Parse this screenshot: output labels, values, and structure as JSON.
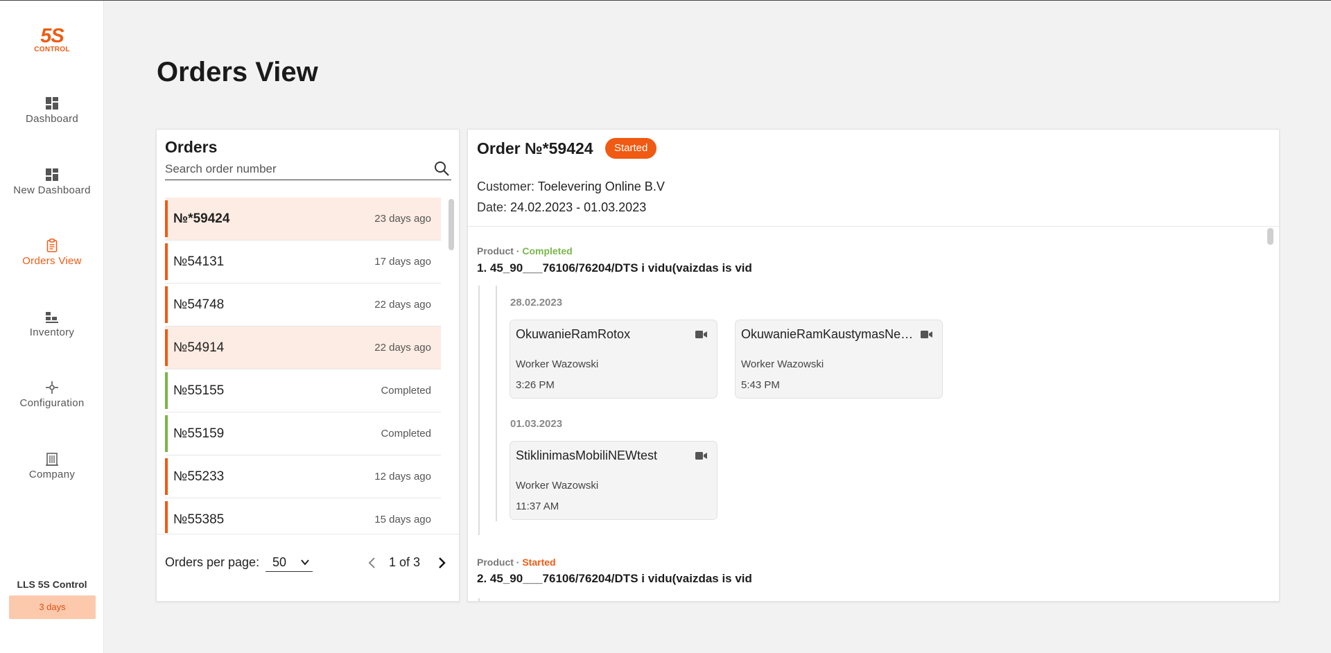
{
  "sidebar": {
    "logo": {
      "big": "5S",
      "small": "CONTROL"
    },
    "items": [
      {
        "label": "Dashboard",
        "icon": "dashboard-icon",
        "active": false
      },
      {
        "label": "New Dashboard",
        "icon": "dashboard-icon",
        "active": false
      },
      {
        "label": "Orders View",
        "icon": "clipboard-icon",
        "active": true
      },
      {
        "label": "Inventory",
        "icon": "inventory-icon",
        "active": false
      },
      {
        "label": "Configuration",
        "icon": "configuration-icon",
        "active": false
      },
      {
        "label": "Company",
        "icon": "building-icon",
        "active": false
      }
    ],
    "brand_name": "LLS 5S Control",
    "trial_badge": "3 days"
  },
  "page": {
    "title": "Orders View"
  },
  "orders_panel": {
    "heading": "Orders",
    "search_placeholder": "Search order number",
    "orders": [
      {
        "number": "№*59424",
        "time": "23 days ago",
        "status": "started",
        "selected": true
      },
      {
        "number": "№54131",
        "time": "17 days ago",
        "status": "started",
        "selected": false
      },
      {
        "number": "№54748",
        "time": "22 days ago",
        "status": "started",
        "selected": false
      },
      {
        "number": "№54914",
        "time": "22 days ago",
        "status": "started",
        "selected": false,
        "highlight": true
      },
      {
        "number": "№55155",
        "time": "Completed",
        "status": "completed",
        "selected": false
      },
      {
        "number": "№55159",
        "time": "Completed",
        "status": "completed",
        "selected": false
      },
      {
        "number": "№55233",
        "time": "12 days ago",
        "status": "started",
        "selected": false
      },
      {
        "number": "№55385",
        "time": "15 days ago",
        "status": "started",
        "selected": false
      }
    ],
    "footer": {
      "per_page_label": "Orders per page:",
      "per_page_value": "50",
      "page_indicator": "1 of 3"
    }
  },
  "detail": {
    "title": "Order №*59424",
    "status": "Started",
    "customer_key": "Customer:",
    "customer_value": "Toelevering Online B.V",
    "date_key": "Date:",
    "date_value": "24.02.2023 - 01.03.2023",
    "products": [
      {
        "label": "Product",
        "status": "Completed",
        "name": "1. 45_90___76106/76204/DTS i vidu(vaizdas is vid",
        "days": [
          {
            "date": "28.02.2023",
            "operations": [
              {
                "name": "OkuwanieRamRotox",
                "worker": "Worker Wazowski",
                "time": "3:26 PM"
              },
              {
                "name": "OkuwanieRamKaustymasNewtest",
                "worker": "Worker Wazowski",
                "time": "5:43 PM"
              }
            ]
          },
          {
            "date": "01.03.2023",
            "operations": [
              {
                "name": "StiklinimasMobiliNEWtest",
                "worker": "Worker Wazowski",
                "time": "11:37 AM"
              }
            ]
          }
        ]
      },
      {
        "label": "Product",
        "status": "Started",
        "name": "2. 45_90___76106/76204/DTS i vidu(vaizdas is vid"
      }
    ]
  },
  "colors": {
    "accent": "#f05a12",
    "completed": "#78b64a",
    "selected_row": "#fdece3",
    "trial_badge_bg": "#fcc9ad"
  }
}
